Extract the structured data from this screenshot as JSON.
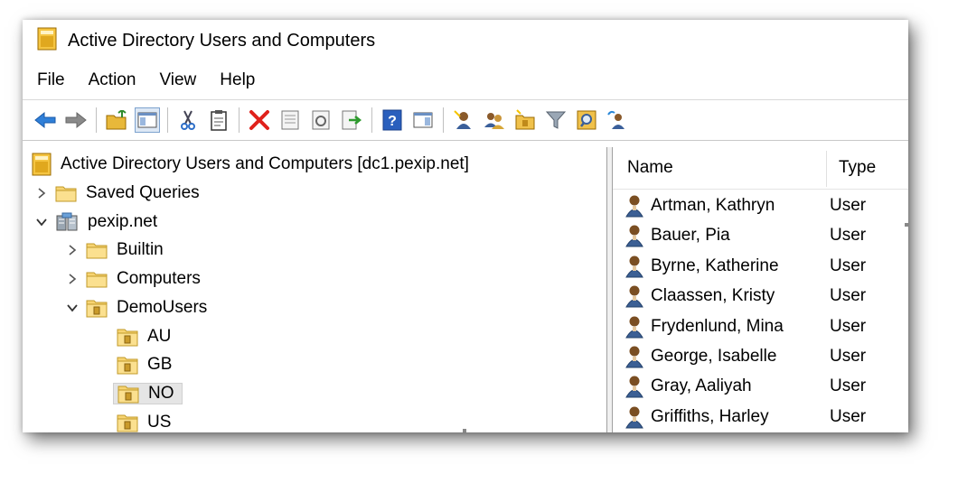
{
  "window": {
    "title": "Active Directory Users and Computers",
    "app_icon": "ad-folder-icon"
  },
  "menu": [
    "File",
    "Action",
    "View",
    "Help"
  ],
  "toolbar": [
    {
      "icon": "back-arrow-icon"
    },
    {
      "icon": "forward-arrow-icon"
    },
    {
      "sep": true
    },
    {
      "icon": "up-folder-icon"
    },
    {
      "icon": "show-console-tree-icon",
      "pressed": true
    },
    {
      "sep": true
    },
    {
      "icon": "cut-icon"
    },
    {
      "icon": "clipboard-icon"
    },
    {
      "sep": true
    },
    {
      "icon": "delete-icon"
    },
    {
      "icon": "properties-icon"
    },
    {
      "icon": "refresh-icon"
    },
    {
      "icon": "export-list-icon"
    },
    {
      "sep": true
    },
    {
      "icon": "help-icon"
    },
    {
      "icon": "action-pane-icon"
    },
    {
      "sep": true
    },
    {
      "icon": "new-user-icon"
    },
    {
      "icon": "new-group-icon"
    },
    {
      "icon": "new-ou-icon"
    },
    {
      "icon": "filter-icon"
    },
    {
      "icon": "find-icon"
    },
    {
      "icon": "add-to-group-icon"
    }
  ],
  "tree": {
    "root": "Active Directory Users and Computers [dc1.pexip.net]",
    "items": [
      {
        "label": "Saved Queries",
        "caret": "right",
        "level": 1,
        "icon": "folder"
      },
      {
        "label": "pexip.net",
        "caret": "down",
        "level": 1,
        "icon": "domain"
      },
      {
        "label": "Builtin",
        "caret": "right",
        "level": 2,
        "icon": "folder"
      },
      {
        "label": "Computers",
        "caret": "right",
        "level": 2,
        "icon": "folder"
      },
      {
        "label": "DemoUsers",
        "caret": "down",
        "level": 2,
        "icon": "ou"
      },
      {
        "label": "AU",
        "caret": "none",
        "level": 3,
        "icon": "ou"
      },
      {
        "label": "GB",
        "caret": "none",
        "level": 3,
        "icon": "ou"
      },
      {
        "label": "NO",
        "caret": "none",
        "level": 3,
        "icon": "ou",
        "selected": true
      },
      {
        "label": "US",
        "caret": "none",
        "level": 3,
        "icon": "ou"
      }
    ]
  },
  "list": {
    "columns": [
      "Name",
      "Type"
    ],
    "rows": [
      {
        "name": "Artman, Kathryn",
        "type": "User"
      },
      {
        "name": "Bauer, Pia",
        "type": "User"
      },
      {
        "name": "Byrne, Katherine",
        "type": "User"
      },
      {
        "name": "Claassen, Kristy",
        "type": "User"
      },
      {
        "name": "Frydenlund, Mina",
        "type": "User"
      },
      {
        "name": "George, Isabelle",
        "type": "User"
      },
      {
        "name": "Gray, Aaliyah",
        "type": "User"
      },
      {
        "name": "Griffiths, Harley",
        "type": "User"
      }
    ]
  }
}
